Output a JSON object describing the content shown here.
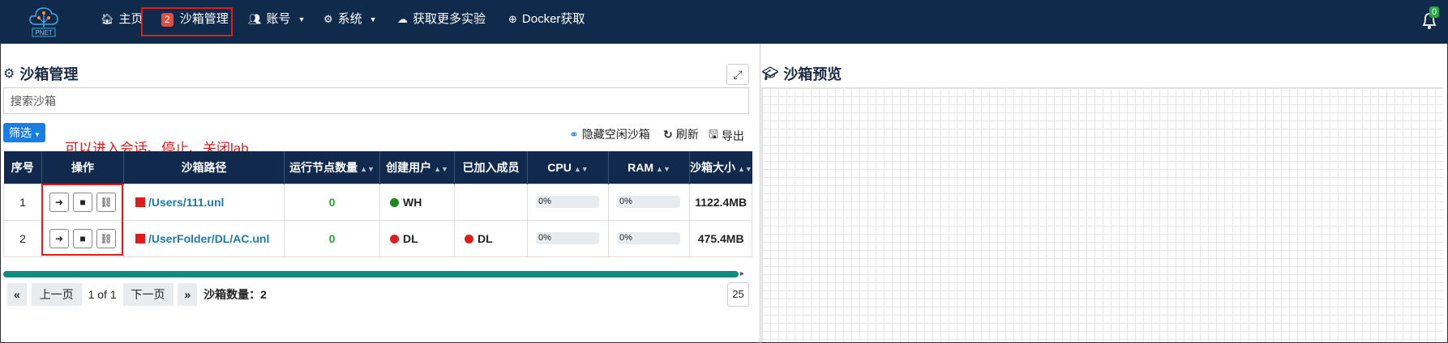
{
  "navbar": {
    "logo_text": "PNET",
    "items": [
      {
        "label": "主页",
        "icon": "home-icon"
      },
      {
        "label": "沙箱管理",
        "badge": "2",
        "icon": ""
      },
      {
        "label": "账号",
        "icon": "users-icon"
      },
      {
        "label": "系统",
        "icon": "gear-icon"
      },
      {
        "label": "获取更多实验",
        "icon": "cloud-download-icon"
      },
      {
        "label": "Docker获取",
        "icon": "plus-circle-icon"
      }
    ],
    "notification_count": "0"
  },
  "left_panel": {
    "title": "沙箱管理",
    "search_placeholder": "搜索沙箱",
    "filter_label": "筛选",
    "annotation": "可以进入会话、停止、关闭lab",
    "tools": {
      "hide_idle": "隐藏空闲沙箱",
      "refresh": "刷新",
      "export": "导出"
    },
    "table": {
      "headers": [
        "序号",
        "操作",
        "沙箱路径",
        "运行节点数量",
        "创建用户",
        "已加入成员",
        "CPU",
        "RAM",
        "沙箱大小"
      ],
      "rows": [
        {
          "index": "1",
          "path": "/Users/111.unl",
          "running_nodes": "0",
          "creator": "WH",
          "creator_status": "#1a8a1a",
          "members": "",
          "members_status": "",
          "cpu": "0%",
          "ram": "0%",
          "size": "1122.4MB"
        },
        {
          "index": "2",
          "path": "/UserFolder/DL/AC.unl",
          "running_nodes": "0",
          "creator": "DL",
          "creator_status": "#e01b1b",
          "members": "DL",
          "members_status": "#e01b1b",
          "cpu": "0%",
          "ram": "0%",
          "size": "475.4MB"
        }
      ]
    },
    "pager": {
      "first": "«",
      "prev": "上一页",
      "page_info": "1 of 1",
      "next": "下一页",
      "last": "»",
      "count_label": "沙箱数量：",
      "count": "2",
      "per_page": "25"
    }
  },
  "right_panel": {
    "title": "沙箱预览"
  },
  "colors": {
    "navbar": "#0f2a4a",
    "accent": "#1a7ee0",
    "highlight": "#e01b1b",
    "progress": "#14897d"
  }
}
